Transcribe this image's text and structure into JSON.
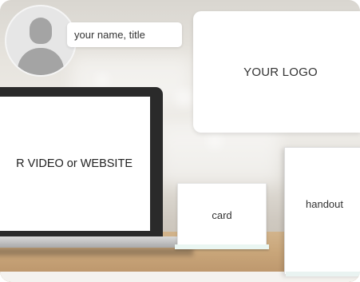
{
  "profile": {
    "name_title": "your name, title",
    "avatar_icon": "user-silhouette-icon"
  },
  "logo": {
    "label": "YOUR LOGO"
  },
  "screen": {
    "label": "R VIDEO or WEBSITE"
  },
  "card": {
    "label": "card"
  },
  "handout": {
    "label": "handout"
  },
  "colors": {
    "background": "#ece9e4",
    "shelf": "#c9a67a",
    "laptop": "#2a2a2a",
    "placeholder_gray": "#a4a4a4"
  }
}
